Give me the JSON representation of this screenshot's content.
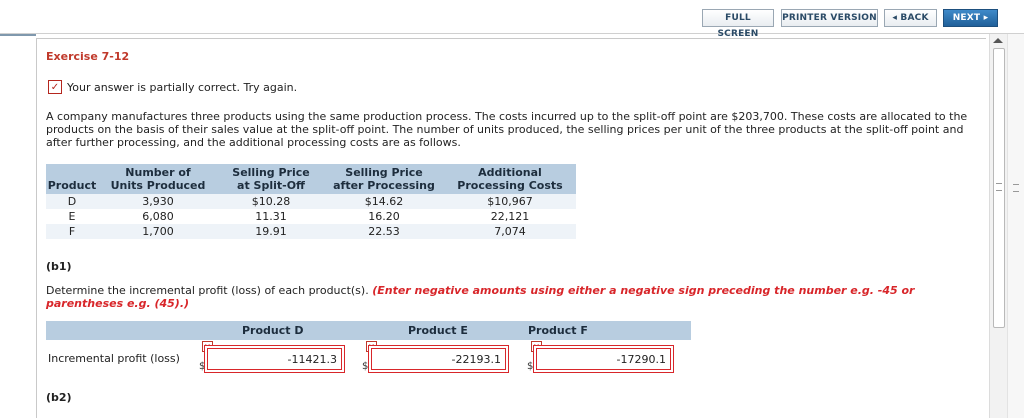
{
  "toolbar": {
    "full_screen": "FULL SCREEN",
    "printer_version": "PRINTER VERSION",
    "back": "◂ BACK",
    "next": "NEXT ▸"
  },
  "exercise": {
    "title": "Exercise 7-12",
    "status": "Your answer is partially correct.  Try again.",
    "problem_text": "A company manufactures three products using the same production process. The costs incurred up to the split-off point are $203,700. These costs are allocated to the products on the basis of their sales value at the split-off point. The number of units produced, the selling prices per unit of the three products at the split-off point and after further processing, and the additional processing costs are as follows."
  },
  "table": {
    "headers": {
      "product": "Product",
      "units_1": "Number of",
      "units_2": "Units Produced",
      "split_1": "Selling Price",
      "split_2": "at Split-Off",
      "after_1": "Selling Price",
      "after_2": "after Processing",
      "add_1": "Additional",
      "add_2": "Processing Costs"
    },
    "rows": [
      {
        "product": "D",
        "units": "3,930",
        "split": "$10.28",
        "after": "$14.62",
        "add": "$10,967"
      },
      {
        "product": "E",
        "units": "6,080",
        "split": "11.31",
        "after": "16.20",
        "add": "22,121"
      },
      {
        "product": "F",
        "units": "1,700",
        "split": "19.91",
        "after": "22.53",
        "add": "7,074"
      }
    ]
  },
  "part_b1": {
    "label": "(b1)",
    "instruction": "Determine the incremental profit (loss) of each product(s).",
    "hint": "(Enter negative amounts using either a negative sign preceding the number e.g. -45 or parentheses e.g. (45).)",
    "columns": [
      "Product D",
      "Product E",
      "Product F"
    ],
    "row_label": "Incremental profit (loss)",
    "currency": "$",
    "answers": [
      "-11421.3",
      "-22193.1",
      "-17290.1"
    ]
  },
  "part_b2": {
    "label": "(b2)"
  }
}
